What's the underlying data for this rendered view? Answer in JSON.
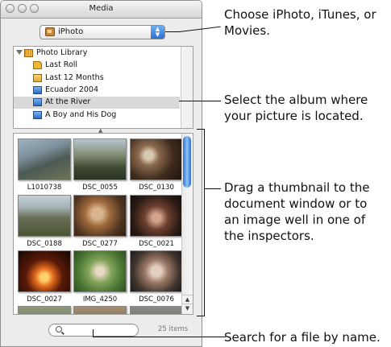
{
  "window": {
    "title": "Media"
  },
  "source_popup": {
    "value": "iPhoto",
    "icon": "iphoto-icon"
  },
  "library": {
    "root": "Photo Library",
    "items": [
      {
        "label": "Last Roll",
        "icon": "last-roll-icon"
      },
      {
        "label": "Last 12 Months",
        "icon": "calendar-icon"
      },
      {
        "label": "Ecuador 2004",
        "icon": "album-icon"
      },
      {
        "label": "At the River",
        "icon": "album-icon",
        "selected": true
      },
      {
        "label": "A Boy and His Dog",
        "icon": "album-icon"
      }
    ]
  },
  "thumbnails": [
    {
      "label": "L1010738"
    },
    {
      "label": "DSC_0055"
    },
    {
      "label": "DSC_0130"
    },
    {
      "label": "DSC_0188"
    },
    {
      "label": "DSC_0277"
    },
    {
      "label": "DSC_0021"
    },
    {
      "label": "DSC_0027"
    },
    {
      "label": "IMG_4250"
    },
    {
      "label": "DSC_0076"
    }
  ],
  "search": {
    "placeholder": "",
    "count": "25 items"
  },
  "callouts": {
    "popup": [
      "Choose iPhoto, iTunes, or",
      "Movies."
    ],
    "album": [
      "Select the album where",
      "your picture is located."
    ],
    "drag": [
      "Drag a thumbnail to the",
      "document window or to",
      "an image well in one of",
      "the inspectors."
    ],
    "search": [
      "Search for a file by name."
    ]
  }
}
